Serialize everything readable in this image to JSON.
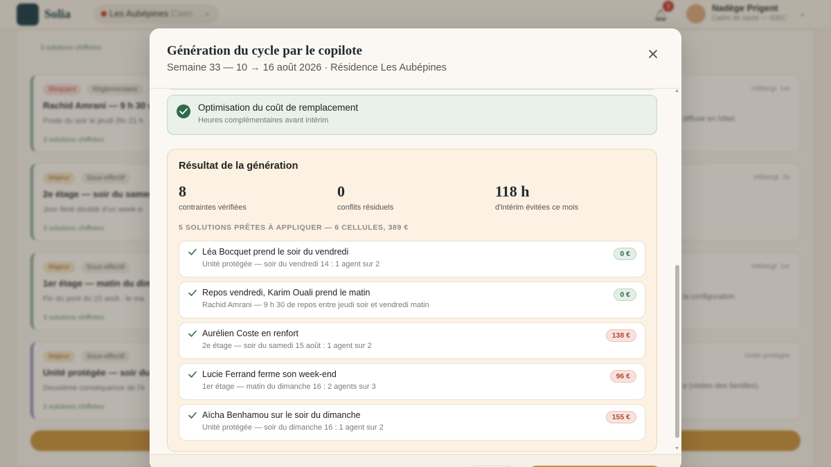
{
  "app": {
    "logo_text": "Solia",
    "site": {
      "name": "Les Aubépines",
      "city": "Caen"
    },
    "notifications_count": "3",
    "user": {
      "name": "Nadège Prigent",
      "role": "Cadre de santé — IDEC"
    }
  },
  "background": {
    "top_link": "3 solutions chiffrées",
    "cards": [
      {
        "chips": [
          {
            "label": "Bloquant",
            "tone": "red"
          },
          {
            "label": "Réglementaire",
            "tone": "neutral"
          }
        ],
        "title": "Rachid Amrani — 9 h 30 de repos",
        "description": "Poste du soir le jeudi (fin 21 h",
        "link": "3 solutions chiffrées",
        "meta": "Hébergt. 1er",
        "right_text": "diffusé en hôtel.",
        "accent": "green"
      },
      {
        "chips": [
          {
            "label": "Majeur",
            "tone": "amber"
          },
          {
            "label": "Sous-effectif",
            "tone": "neutral"
          }
        ],
        "title": "2e étage — soir du samedi",
        "description": "Jour férié doublé d'un week-e",
        "link": "3 solutions chiffrées",
        "meta": "Hébergt. 2e",
        "right_text": "",
        "accent": "green"
      },
      {
        "chips": [
          {
            "label": "Majeur",
            "tone": "amber"
          },
          {
            "label": "Sous-effectif",
            "tone": "neutral"
          }
        ],
        "title": "1er étage — matin du dim",
        "description": "Fin du pont du 15 août : le ma",
        "link": "3 solutions chiffrées",
        "meta": "Hébergt. 1er",
        "right_text": "la configuration.",
        "accent": "green"
      },
      {
        "chips": [
          {
            "label": "Majeur",
            "tone": "amber"
          },
          {
            "label": "Sous-effectif",
            "tone": "neutral"
          }
        ],
        "title": "Unité protégée — soir du",
        "description": "Deuxième conséquence de l'é",
        "link": "3 solutions chiffrées",
        "meta": "Unité protégée",
        "right_text": "e (visites des familles).",
        "accent": "purple"
      }
    ]
  },
  "modal": {
    "title": "Génération du cycle par le copilote",
    "subtitle": "Semaine 33 — 10 → 16 août 2026 · Résidence Les Aubépines",
    "step": {
      "title": "Optimisation du coût de remplacement",
      "subtitle": "Heures complémentaires avant intérim"
    },
    "result": {
      "title": "Résultat de la génération",
      "stats": [
        {
          "value": "8",
          "label": "contraintes vérifiées"
        },
        {
          "value": "0",
          "label": "conflits résiduels"
        },
        {
          "value": "118 h",
          "label": "d'intérim évitées ce mois"
        }
      ],
      "ready_heading": "5 SOLUTIONS PRÊTES À APPLIQUER — 6 CELLULES, 389 €",
      "solutions": [
        {
          "title": "Léa Bocquet prend le soir du vendredi",
          "detail": "Unité protégée — soir du vendredi 14 : 1 agent sur 2",
          "cost": "0 €",
          "kind": "free"
        },
        {
          "title": "Repos vendredi, Karim Ouali prend le matin",
          "detail": "Rachid Amrani — 9 h 30 de repos entre jeudi soir et vendredi matin",
          "cost": "0 €",
          "kind": "free"
        },
        {
          "title": "Aurélien Coste en renfort",
          "detail": "2e étage — soir du samedi 15 août : 1 agent sur 2",
          "cost": "138 €",
          "kind": "paid"
        },
        {
          "title": "Lucie Ferrand ferme son week-end",
          "detail": "1er étage — matin du dimanche 16 : 2 agents sur 3",
          "cost": "96 €",
          "kind": "paid"
        },
        {
          "title": "Aïcha Benhamou sur le soir du dimanche",
          "detail": "Unité protégée — soir du dimanche 16 : 1 agent sur 2",
          "cost": "155 €",
          "kind": "paid"
        }
      ]
    }
  },
  "colors": {
    "brand": "#173b47",
    "accent": "#c9913a",
    "success": "#2f6b4c",
    "cost_paid": "#b2493a"
  }
}
